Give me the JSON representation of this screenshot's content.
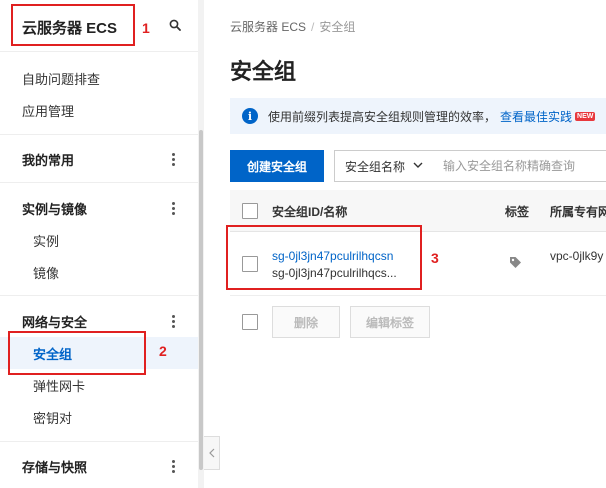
{
  "sidebar": {
    "title": "云服务器 ECS",
    "items": [
      {
        "label": "自助问题排查"
      },
      {
        "label": "应用管理"
      },
      {
        "label": "我的常用"
      },
      {
        "label": "实例与镜像"
      },
      {
        "label": "实例"
      },
      {
        "label": "镜像"
      },
      {
        "label": "网络与安全"
      },
      {
        "label": "安全组"
      },
      {
        "label": "弹性网卡"
      },
      {
        "label": "密钥对"
      },
      {
        "label": "存储与快照"
      }
    ]
  },
  "breadcrumb": {
    "root": "云服务器 ECS",
    "separator": "/",
    "current": "安全组"
  },
  "page": {
    "title": "安全组"
  },
  "tip": {
    "text": "使用前缀列表提高安全组规则管理的效率，",
    "link": "查看最佳实践",
    "badge": "NEW"
  },
  "toolbar": {
    "create_label": "创建安全组",
    "filter_selected": "安全组名称",
    "search_placeholder": "输入安全组名称精确查询"
  },
  "table": {
    "columns": [
      "安全组ID/名称",
      "标签",
      "所属专有网"
    ],
    "rows": [
      {
        "id": "sg-0jl3jn47pculrilhqcsn",
        "name": "sg-0jl3jn47pculrilhqcs...",
        "vpc": "vpc-0jlk9y"
      }
    ]
  },
  "bulk": {
    "delete_label": "删除",
    "edit_tags_label": "编辑标签"
  },
  "annotations": {
    "n1": "1",
    "n2": "2",
    "n3": "3"
  },
  "colors": {
    "accent": "#0064c8",
    "annotation": "#e02020",
    "active_bg": "#eef4fc"
  }
}
